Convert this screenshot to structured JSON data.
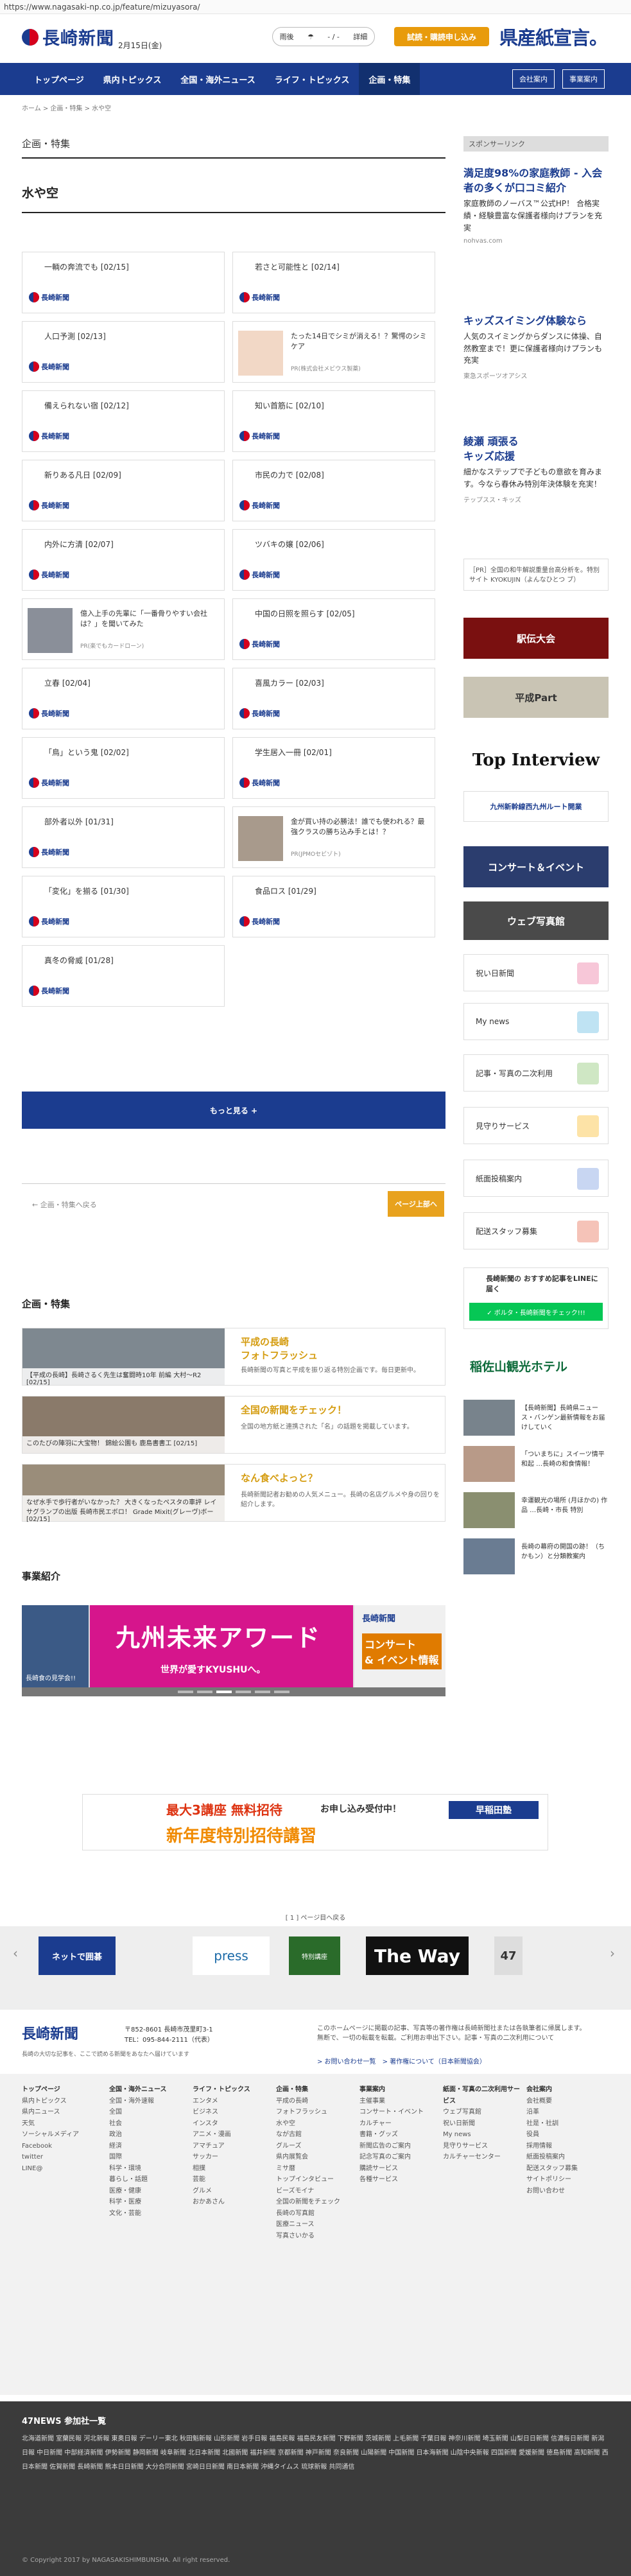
{
  "url": "https://www.nagasaki-np.co.jp/feature/mizuyasora/",
  "header": {
    "logo": "長崎新聞",
    "date": "2月15日(金)",
    "weather_label": "雨後",
    "weather_temp": "- / -",
    "weather_more": "詳細",
    "trial_button": "試読・購読申し込み",
    "kenken": "県産紙宣言。"
  },
  "nav": {
    "items": [
      "トップページ",
      "県内トピックス",
      "全国・海外ニュース",
      "ライフ・トピックス",
      "企画・特集"
    ],
    "right": [
      "会社案内",
      "事業案内"
    ]
  },
  "breadcrumb": "ホーム  >  企画・特集  >  水や空",
  "section_title": "企画・特集",
  "page_title": "水や空",
  "cards": [
    {
      "t": "一輌の奔流でも [02/15]"
    },
    {
      "t": "若さと可能性と [02/14]"
    },
    {
      "t": "人口予測 [02/13]"
    },
    {
      "t": "たった14日でシミが消える！？驚愕のシミケア",
      "ad": "PR(株式会社メビウス製薬)"
    },
    {
      "t": "備えられない宿 [02/12]"
    },
    {
      "t": "知い首筋に [02/10]"
    },
    {
      "t": "新りある凡日 [02/09]"
    },
    {
      "t": "市民の力で [02/08]"
    },
    {
      "t": "内外に方清 [02/07]"
    },
    {
      "t": "ツバキの嬢 [02/06]"
    },
    {
      "t": "億入上手の先輩に「一番骨りやすい会社は？」を聞いてみた",
      "ad": "PR(楽でもカードローン)"
    },
    {
      "t": "中国の日照を照らす [02/05]"
    },
    {
      "t": "立春 [02/04]"
    },
    {
      "t": "喜風カラー [02/03]"
    },
    {
      "t": "「鳥」という鬼 [02/02]"
    },
    {
      "t": "学生居入一冊 [02/01]"
    },
    {
      "t": "部外者以外 [01/31]"
    },
    {
      "t": "金が買い持の必勝法！誰でも使われる？最強クラスの勝ち込み手とは！？",
      "ad": "PR(JPMOセビゾト)"
    },
    {
      "t": "「変化」を揃る [01/30]"
    },
    {
      "t": "食品ロス [01/29]"
    },
    {
      "t": "真冬の脅威 [01/28]"
    }
  ],
  "paper_small": "長崎新聞",
  "more_button": "もっと見る +",
  "back_link": "← 企画・特集へ戻る",
  "pagetop": "ページ上部へ",
  "features_title": "企画・特集",
  "features": [
    {
      "cap": "【平成の長崎】長崎さるく先生は奮闘時10年 前編 大村～R2 [02/15]",
      "title": "平成の長崎\nフォトフラッシュ",
      "desc": "長崎新聞の写真と平成を振り返る特別企画です。毎日更新中。"
    },
    {
      "cap": "このたびの陣羽に大宝物！ 錦絵公園も 鹿島書書工 [02/15]",
      "title": "全国の新聞をチェック！",
      "desc": "全国の地方紙と連携された「名」の話題を掲載しています。"
    },
    {
      "cap": "なぜ水手で歩行者がいなかった？ 大きくなったペスタの車評 レイサグランプの出版 長崎市民エボロ！ Grade Mixit(グレーヴ)ボー [02/15]",
      "title": "なん食べよっと？",
      "desc": "長崎新聞記者お勧めの人気メニュー。長崎の名店グルメや身の回りを紹介します。"
    }
  ],
  "business_title": "事業紹介",
  "slider": {
    "main": "九州未来アワード",
    "sub": "世界が愛すKYUSHUへ。",
    "left": "長崎食の見学会!!",
    "right_logo": "長崎新聞",
    "right_sub": "コンサート\n& イベント情報"
  },
  "sidebar": {
    "sponsor": "スポンサーリンク",
    "ads": [
      {
        "t": "満足度98%の家庭教師 - 入会者の多くが口コミ紹介",
        "d": "家庭教師のノーバス™公式HP！ 合格実績・経験豊富な保護者様向けプランを充実",
        "s": "nohvas.com"
      },
      {
        "t": "キッズスイミング体験なら",
        "d": "人気のスイミングからダンスに体操、自然教室まで！更に保護者様向けプランも充実",
        "s": "東急スポーツオアシス"
      },
      {
        "t": "綾瀬 頑張る\nキッズ応援",
        "d": "細かなステップで子どもの意欲を育みます。今なら春休み特別年決体験を充実！",
        "s": "テップスス・キッズ"
      }
    ],
    "pr": "［PR］全国の和牛解説重量台高分析を。特別サイト KYOKUJIN（よんなひとつ ブ）",
    "banners": [
      "駅伝大会",
      "平成Part",
      "Top Interview",
      "九州新幹線西九州ルート開業",
      "コンサート＆イベント",
      "ウェブ写真館"
    ],
    "services": [
      "祝い日新聞",
      "My news",
      "記事・写真の二次利用",
      "見守りサービス",
      "紙面投稿案内",
      "配送スタッフ募集"
    ],
    "line": "長崎新聞の おすすめ記事をLINEに届く",
    "line_btn": "✓ ボルタ・長崎新聞をチェック!!!",
    "hotel": "稲佐山観光ホテル",
    "news": [
      {
        "t": "【長崎新聞】長崎県ニュース・バンゲン最新情報をお届けしていく"
      },
      {
        "t": "「ついまちに」スイーツ情平和起 …長崎の和食情報！"
      },
      {
        "t": "幸運観光の場所 (月ほかの) 作品 …長崎・市長 特別"
      },
      {
        "t": "長崎の幕府の開国の跡！（ちかもン）と分類教案内"
      }
    ]
  },
  "bottom_ad": {
    "t1": "最大3講座 無料招待",
    "t2": "お申し込み受付中！",
    "t3": "新年度特別招待講習",
    "brand": "早稲田塾"
  },
  "logos_pager": "[ 1 ] ページ目へ戻る",
  "logos": [
    "ネットで囲碁",
    "press",
    "特別講座",
    "The Way",
    "47"
  ],
  "footer_info": {
    "logo": "長崎新聞",
    "addr": "〒852-8601  長崎市茂里町3-1",
    "tel": "TEL：095-844-2111（代表）",
    "note": "長崎の大切な記事を、ここで読める新聞をあなたへ届けています",
    "legal": "このホームページに掲載の記事、写真等の著作権は長崎新聞社または各執筆者に帰属します。\n無断で、一切の転載を転載。ご利用お申出下さい。記事・写真の二次利用について",
    "links": [
      "> お問い合わせ一覧",
      "> 著作権について（日本新聞協会）"
    ]
  },
  "footer_cols": [
    {
      "h": "トップページ",
      "i": [
        "県内トピックス",
        "県内ニュース",
        "天気",
        "ソーシャルメディア",
        "Facebook",
        "twitter",
        "LINE@"
      ]
    },
    {
      "h": "全国・海外ニュース",
      "i": [
        "全国・海外速報",
        "全国",
        "社会",
        "政治",
        "経済",
        "国際",
        "科学・環境",
        "暮らし・話題",
        "医療・健康",
        "科学・医療",
        "文化・芸能"
      ]
    },
    {
      "h": "ライフ・トピックス",
      "i": [
        "エンタメ",
        "ビジネス",
        "インスタ",
        "アニメ・漫画",
        "アマチュア",
        "サッカー",
        "相撲",
        "芸能",
        "グルメ",
        "おかあさん"
      ]
    },
    {
      "h": "企画・特集",
      "i": [
        "平成の長崎",
        "フォトフラッシュ",
        "水や空",
        "なが古館",
        "グルーズ",
        "県内展覧会",
        "ミサ暦",
        "トップインタビュー",
        "ビーズモイナ",
        "全国の新聞をチェック",
        "長崎の写真館",
        "医療ニュース",
        "写真さいかる"
      ]
    },
    {
      "h": "事業案内",
      "i": [
        "主催事業",
        "コンサート・イベント",
        "カルチャー",
        "書籍・グッズ",
        "新聞広告のご案内",
        "記念写真のご案内",
        "購読サービス",
        "各種サービス"
      ]
    },
    {
      "h": "紙面・写真の二次利用サービス",
      "i": [
        "ウェブ写真館",
        "祝い日新聞",
        "My news",
        "見守りサービス",
        "カルチャーセンター"
      ]
    },
    {
      "h": "会社案内",
      "i": [
        "会社概要",
        "沿革",
        "社是・社訓",
        "役員",
        "採用情報",
        "紙面投稿案内",
        "配送スタッフ募集",
        "サイトポリシー",
        "お問い合わせ"
      ]
    }
  ],
  "np47": {
    "title": "47NEWS 参加社一覧",
    "row": "北海道新聞  室蘭民報  河北新報  東奥日報  デーリー東北  秋田魁新報  山形新聞  岩手日報  福島民報  福島民友新聞  下野新聞  茨城新聞  上毛新聞  千葉日報  神奈川新聞  埼玉新聞  山梨日日新聞  信濃毎日新聞  新潟日報  中日新聞  中部経済新聞  伊勢新聞  静岡新聞  岐阜新聞  北日本新聞  北國新聞  福井新聞  京都新聞  神戸新聞  奈良新聞  山陽新聞  中国新聞  日本海新聞  山陰中央新報  四国新聞  愛媛新聞  徳島新聞  高知新聞  西日本新聞  佐賀新聞  長崎新聞  熊本日日新聞  大分合同新聞  宮崎日日新聞  南日本新聞  沖縄タイムス  琉球新報  共同通信"
  },
  "copyright": "© Copyright 2017 by NAGASAKISHIMBUNSHA. All right reserved."
}
